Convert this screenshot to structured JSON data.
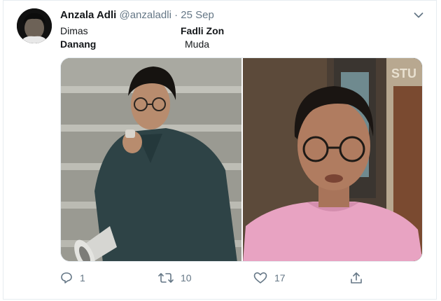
{
  "tweet": {
    "author_name": "Anzala Adli",
    "author_handle": "@anzaladli",
    "separator": "·",
    "date": "25 Sep",
    "lines": {
      "left_top": "Dimas",
      "right_top": "Fadli Zon",
      "left_bottom": "Danang",
      "right_bottom": "Muda"
    }
  },
  "actions": {
    "reply_count": "1",
    "retweet_count": "10",
    "like_count": "17"
  },
  "icons": {
    "menu": "chevron-down-icon",
    "reply": "reply-icon",
    "retweet": "retweet-icon",
    "like": "heart-icon",
    "share": "share-icon"
  },
  "colors": {
    "secondary_text": "#657786",
    "primary_text": "#14171a",
    "border": "#e6ecf0"
  }
}
